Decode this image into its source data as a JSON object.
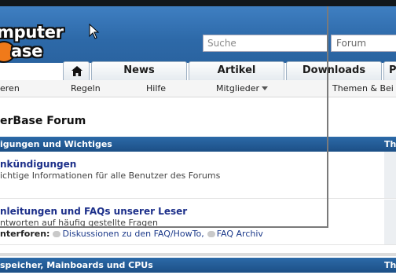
{
  "logo": {
    "line1": "mputer",
    "line2": "ase"
  },
  "search": {
    "placeholder": "Suche",
    "scope": "Forum"
  },
  "tabs": [
    {
      "label": "News"
    },
    {
      "label": "Artikel"
    },
    {
      "label": "Downloads"
    },
    {
      "label": "P"
    }
  ],
  "subnav": {
    "items": [
      "eren",
      "Regeln",
      "Hilfe",
      "Mitglieder",
      "Themen & Bei"
    ]
  },
  "page_title": "erBase Forum",
  "category1": {
    "title": "igungen und Wichtiges",
    "right": "Th"
  },
  "forums": [
    {
      "title": "nkündigungen",
      "desc": "ichtige Informationen für alle Benutzer des Forums"
    },
    {
      "title": "nleitungen und FAQs unserer Leser",
      "desc": "ntworten auf häufig gestellte Fragen",
      "subforums_label": "nterforen:",
      "subforums": [
        "Diskussionen zu den FAQ/HowTo,",
        "FAQ Archiv"
      ]
    }
  ],
  "category2": {
    "title": "speicher, Mainboards und CPUs",
    "right": "Th"
  },
  "colors": {
    "header": "#2d69a8",
    "catbar": "#1c4f86",
    "link": "#1c2f8a",
    "logo_orange": "#f07a1a"
  }
}
